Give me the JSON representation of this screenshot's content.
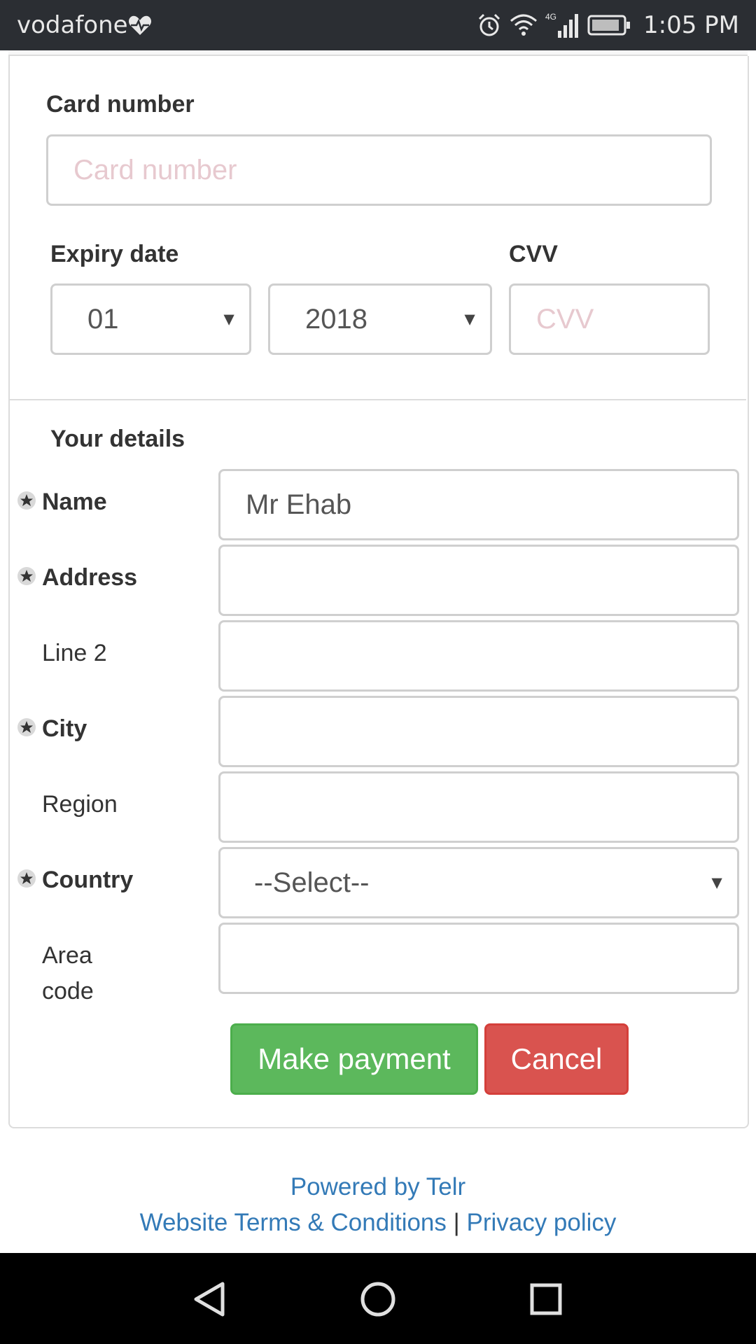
{
  "status_bar": {
    "carrier": "vodafone",
    "time": "1:05 PM",
    "network": "4G"
  },
  "card": {
    "card_number_label": "Card number",
    "card_number_placeholder": "Card number",
    "expiry_label": "Expiry date",
    "expiry_month": "01",
    "expiry_year": "2018",
    "cvv_label": "CVV",
    "cvv_placeholder": "CVV"
  },
  "details": {
    "heading": "Your details",
    "fields": {
      "name": {
        "label": "Name",
        "value": "Mr Ehab"
      },
      "address": {
        "label": "Address",
        "value": ""
      },
      "line2": {
        "label": "Line 2",
        "value": ""
      },
      "city": {
        "label": "City",
        "value": ""
      },
      "region": {
        "label": "Region",
        "value": ""
      },
      "country": {
        "label": "Country",
        "value": "--Select--"
      },
      "area_code": {
        "label_line1": "Area",
        "label_line2": "code",
        "value": ""
      }
    }
  },
  "actions": {
    "make_payment": "Make payment",
    "cancel": "Cancel"
  },
  "footer": {
    "powered_by": "Powered by Telr",
    "terms": "Website Terms & Conditions",
    "separator": "|",
    "privacy": "Privacy policy"
  },
  "colors": {
    "status_bar_bg": "#2b2e33",
    "primary_button": "#5cb85c",
    "danger_button": "#d9534f",
    "link": "#337ab7",
    "placeholder": "#e7c9cf"
  }
}
